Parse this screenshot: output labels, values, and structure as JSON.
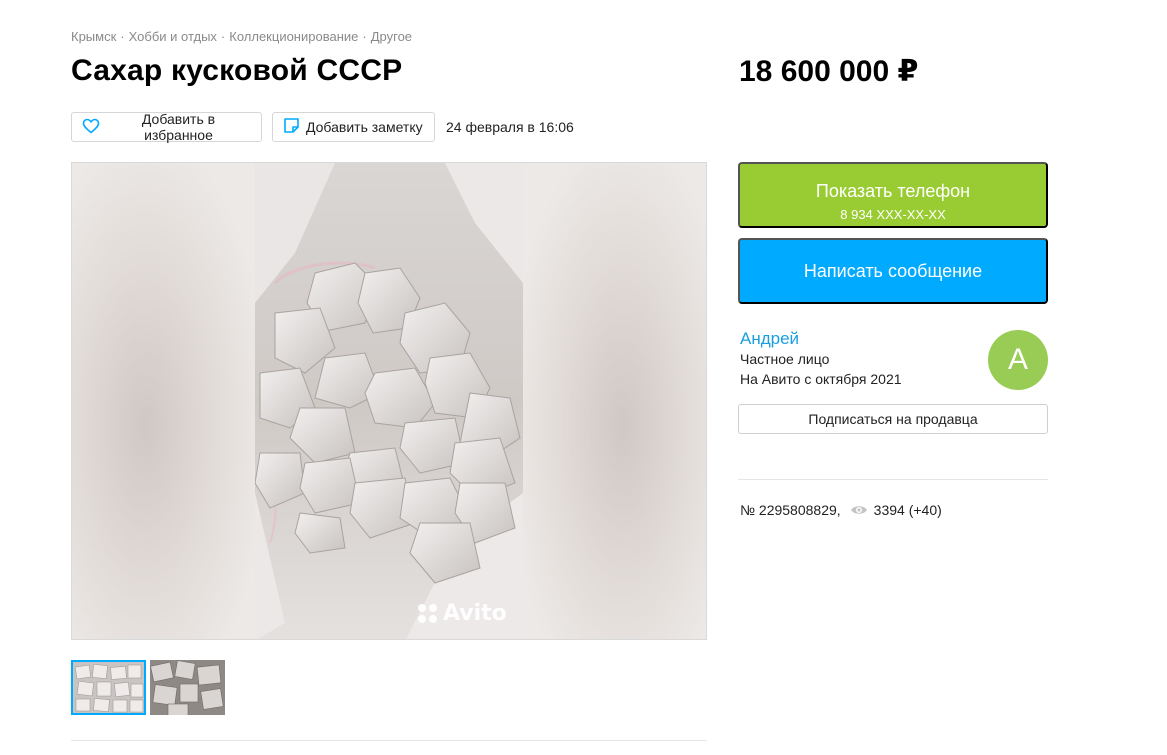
{
  "breadcrumb": [
    "Крымск",
    "Хобби и отдых",
    "Коллекционирование",
    "Другое"
  ],
  "breadcrumb_separator": "·",
  "title": "Сахар кусковой СССР",
  "price": "18 600 000 ₽",
  "actions": {
    "favorite_label": "Добавить в избранное",
    "note_label": "Добавить заметку",
    "date": "24 февраля в 16:06"
  },
  "gallery": {
    "watermark": "Avito",
    "thumbnail_count": 2,
    "selected_thumbnail": 1
  },
  "contact": {
    "phone_button_label": "Показать телефон",
    "phone_masked": "8 934 XXX-XX-XX",
    "message_button_label": "Написать сообщение"
  },
  "seller": {
    "name": "Андрей",
    "type": "Частное лицо",
    "since": "На Авито с октября 2021",
    "avatar_letter": "А",
    "subscribe_label": "Подписаться на продавца"
  },
  "listing": {
    "number": "№ 2295808829,",
    "views": "3394 (+40)"
  },
  "colors": {
    "phone_button": "#99cc33",
    "message_button": "#00aaff",
    "seller_link": "#1a9ee0",
    "avatar": "#99cc55",
    "icon_accent": "#00aaff"
  }
}
